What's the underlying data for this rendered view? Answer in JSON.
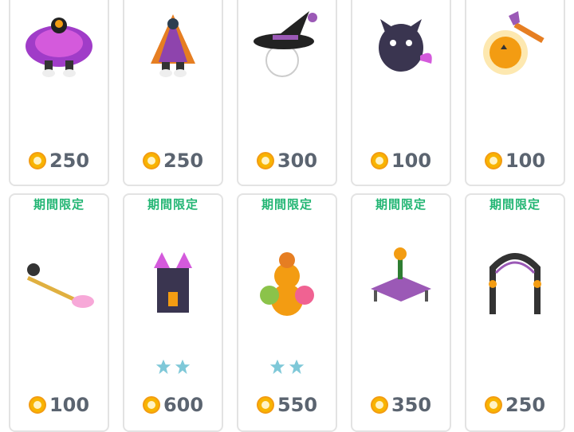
{
  "badge_label": "期間限定",
  "row1": [
    {
      "name": "purple-halloween-dress",
      "price": "250"
    },
    {
      "name": "orange-witch-outfit",
      "price": "250"
    },
    {
      "name": "witch-hat",
      "price": "300"
    },
    {
      "name": "black-cat-plush",
      "price": "100"
    },
    {
      "name": "pumpkin-magic-wand",
      "price": "100"
    }
  ],
  "row2": [
    {
      "name": "cat-broomstick",
      "price": "100",
      "stars": 0
    },
    {
      "name": "haunted-castle",
      "price": "600",
      "stars": 2
    },
    {
      "name": "pumpkin-tower",
      "price": "550",
      "stars": 2
    },
    {
      "name": "halloween-table",
      "price": "350",
      "stars": 0
    },
    {
      "name": "halloween-arch",
      "price": "250",
      "stars": 0
    }
  ],
  "colors": {
    "badge": "#22b573",
    "price": "#5b6470",
    "coin": "#f8b400",
    "star": "#7ec8d8"
  }
}
